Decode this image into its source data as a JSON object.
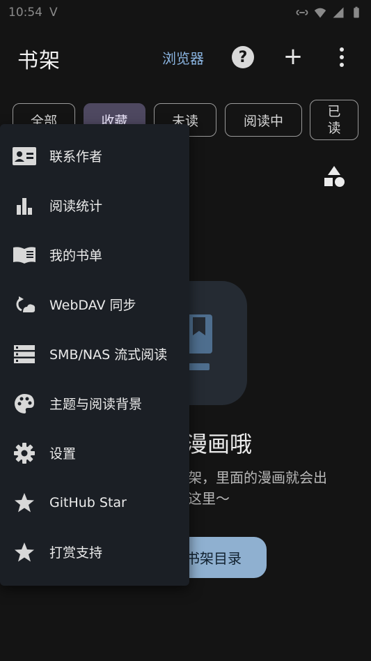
{
  "status_bar": {
    "time": "10:54",
    "carrier_mark": "V"
  },
  "app_bar": {
    "title": "书架",
    "browser_label": "浏览器",
    "help_label": "?",
    "add_label": "+"
  },
  "chips": [
    {
      "label": "全部",
      "selected": false
    },
    {
      "label": "收藏",
      "selected": true
    },
    {
      "label": "未读",
      "selected": false
    },
    {
      "label": "阅读中",
      "selected": false
    },
    {
      "label_line1": "已",
      "label_line2": "读",
      "selected": false
    }
  ],
  "empty_state": {
    "title": "漫画哦",
    "description_line1": "架，里面的漫画就会出",
    "description_line2": "这里～",
    "button_label": "书架目录"
  },
  "menu": {
    "items": [
      {
        "label": "联系作者",
        "icon": "contact-card-icon"
      },
      {
        "label": "阅读统计",
        "icon": "bar-chart-icon"
      },
      {
        "label": "我的书单",
        "icon": "book-open-icon"
      },
      {
        "label": "WebDAV 同步",
        "icon": "cloud-sync-icon"
      },
      {
        "label": "SMB/NAS 流式阅读",
        "icon": "storage-icon"
      },
      {
        "label": "主题与阅读背景",
        "icon": "palette-icon"
      },
      {
        "label": "设置",
        "icon": "gear-icon"
      },
      {
        "label": "GitHub Star",
        "icon": "star-icon"
      },
      {
        "label": "打赏支持",
        "icon": "star-icon"
      }
    ]
  },
  "colors": {
    "background": "#141414",
    "menu_background": "#1b1f25",
    "accent_link": "#8ab4e0",
    "chip_selected": "#4e4860",
    "button_primary": "#8fb0d0"
  }
}
